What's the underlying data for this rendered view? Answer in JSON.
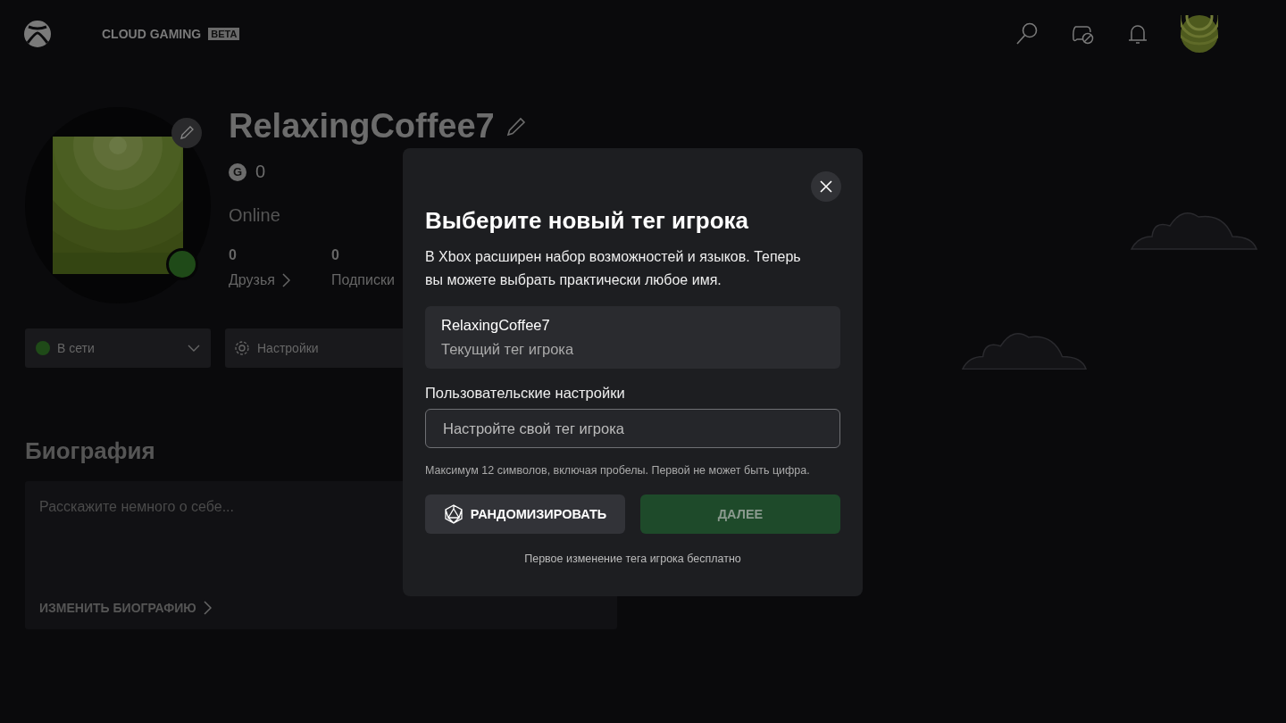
{
  "header": {
    "brand": "CLOUD GAMING",
    "badge": "BETA"
  },
  "profile": {
    "gamertag": "RelaxingCoffee7",
    "gamerscore_icon": "G",
    "gamerscore": "0",
    "presence": "Online",
    "stats": [
      {
        "count": "0",
        "label": "Друзья",
        "chevron": true
      },
      {
        "count": "0",
        "label": "Подписки",
        "chevron": false
      }
    ]
  },
  "status_select": {
    "value": "В сети"
  },
  "settings_button": "Настройки",
  "bio": {
    "heading": "Биография",
    "placeholder": "Расскажите немного о себе...",
    "edit_link": "ИЗМЕНИТЬ БИОГРАФИЮ"
  },
  "dialog": {
    "title": "Выберите новый тег игрока",
    "body": "В Xbox расширен набор возможностей и языков. Теперь вы можете выбрать практически любое имя.",
    "current": {
      "gamertag": "RelaxingCoffee7",
      "caption": "Текущий тег игрока"
    },
    "field_label": "Пользовательские настройки",
    "placeholder": "Настройте свой тег игрока",
    "hint": "Максимум 12 символов, включая пробелы. Первой не может быть цифра.",
    "randomize": "РАНДОМИЗИРОВАТЬ",
    "next": {
      "label": "ДАЛЕЕ",
      "disabled": true
    },
    "footnote": "Первое изменение тега игрока бесплатно"
  }
}
